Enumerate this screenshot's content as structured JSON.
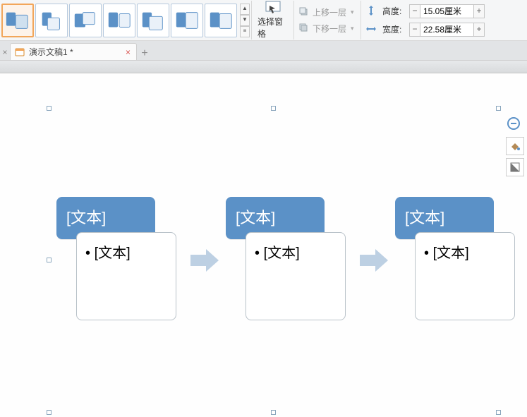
{
  "ribbon": {
    "select_pane_label": "选择窗格",
    "bring_forward_label": "上移一层",
    "send_backward_label": "下移一层",
    "height_label": "高度:",
    "width_label": "宽度:",
    "height_value": "15.05厘米",
    "width_value": "22.58厘米",
    "minus": "−",
    "plus": "+",
    "gallery_up": "▲",
    "gallery_down": "▼",
    "layer_dropdown_caret": "▾"
  },
  "tabs": {
    "doc_title": "演示文稿1 *",
    "close_glyph": "×",
    "plus_glyph": "+"
  },
  "smartart": {
    "title_placeholder": "[文本]",
    "bullet_placeholder": "[文本]"
  },
  "sidebar_tools": {
    "remove": "remove",
    "fill": "fill",
    "contrast": "contrast"
  }
}
